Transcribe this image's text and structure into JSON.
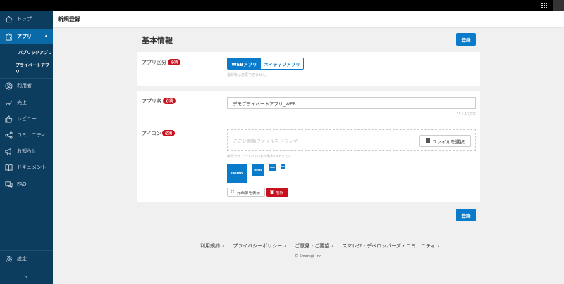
{
  "header": {
    "title": "新規登録"
  },
  "sidebar": {
    "items": [
      {
        "label": "トップ",
        "icon": "home-icon"
      },
      {
        "label": "アプリ",
        "icon": "puzzle-icon"
      },
      {
        "label": "利用者",
        "icon": "user-icon"
      },
      {
        "label": "売上",
        "icon": "chart-icon"
      },
      {
        "label": "レビュー",
        "icon": "thumbs-up-icon"
      },
      {
        "label": "コミュニティ",
        "icon": "share-icon"
      },
      {
        "label": "お知らせ",
        "icon": "megaphone-icon"
      },
      {
        "label": "ドキュメント",
        "icon": "book-icon"
      },
      {
        "label": "FAQ",
        "icon": "chat-icon"
      },
      {
        "label": "設定",
        "icon": "gear-icon"
      }
    ],
    "subitems": [
      {
        "label": "パブリックアプリ"
      },
      {
        "label": "プライベートアプリ"
      }
    ]
  },
  "main": {
    "section_title": "基本情報",
    "register_label": "登録",
    "required_label": "必須",
    "app_type": {
      "label": "アプリ区分",
      "options": [
        "WEBアプリ",
        "ネイティブアプリ"
      ],
      "selected": "WEBアプリ",
      "help": "登録後は変更できません。"
    },
    "app_name": {
      "label": "アプリ名",
      "value": "デモプライベートアプリ_WEB",
      "counter": "15 / 40文字"
    },
    "icon": {
      "label": "アイコン",
      "drop_placeholder": "ここに画像ファイルをドラッグ",
      "file_button": "ファイルを選択",
      "size_help": "推奨サイズ 512*512px(最大1MBまで)",
      "preview_text": "Demo",
      "show_full_label": "元画像を表示",
      "delete_label": "削除"
    }
  },
  "footer": {
    "links": [
      "利用規約",
      "プライバシーポリシー",
      "ご意見・ご要望",
      "スマレジ・デベロッパーズ・コミュニティ"
    ],
    "copyright": "© Smaregi, Inc."
  },
  "colors": {
    "sidebar": "#0c3c5e",
    "active": "#0a6aa8",
    "primary": "#0a7acb",
    "required": "#c8101e"
  }
}
